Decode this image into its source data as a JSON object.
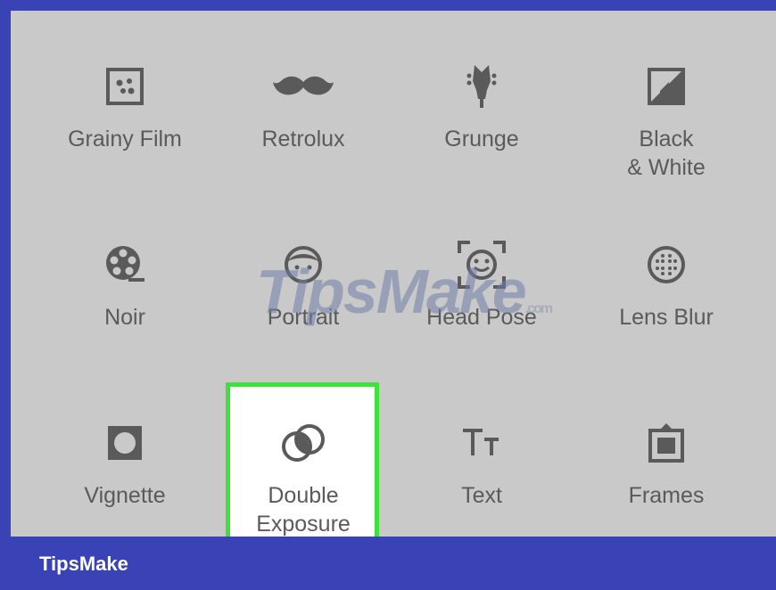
{
  "tools": [
    {
      "label": "Grainy Film",
      "icon": "grainy-film-icon"
    },
    {
      "label": "Retrolux",
      "icon": "mustache-icon"
    },
    {
      "label": "Grunge",
      "icon": "guitar-icon"
    },
    {
      "label": "Black\n& White",
      "icon": "black-white-icon"
    },
    {
      "label": "Noir",
      "icon": "film-reel-icon"
    },
    {
      "label": "Portrait",
      "icon": "face-icon"
    },
    {
      "label": "Head Pose",
      "icon": "face-frame-icon"
    },
    {
      "label": "Lens Blur",
      "icon": "lens-blur-icon"
    },
    {
      "label": "Vignette",
      "icon": "vignette-icon"
    },
    {
      "label": "Double\nExposure",
      "icon": "double-exposure-icon"
    },
    {
      "label": "Text",
      "icon": "text-icon"
    },
    {
      "label": "Frames",
      "icon": "frames-icon"
    }
  ],
  "watermark": {
    "main": "TipsMake",
    "suffix": ".com"
  },
  "footer": {
    "brand": "TipsMake"
  },
  "colors": {
    "background": "#c9c9c9",
    "border": "#3a43b6",
    "highlight": "#3fe23a",
    "icon": "#5a5a5a"
  }
}
